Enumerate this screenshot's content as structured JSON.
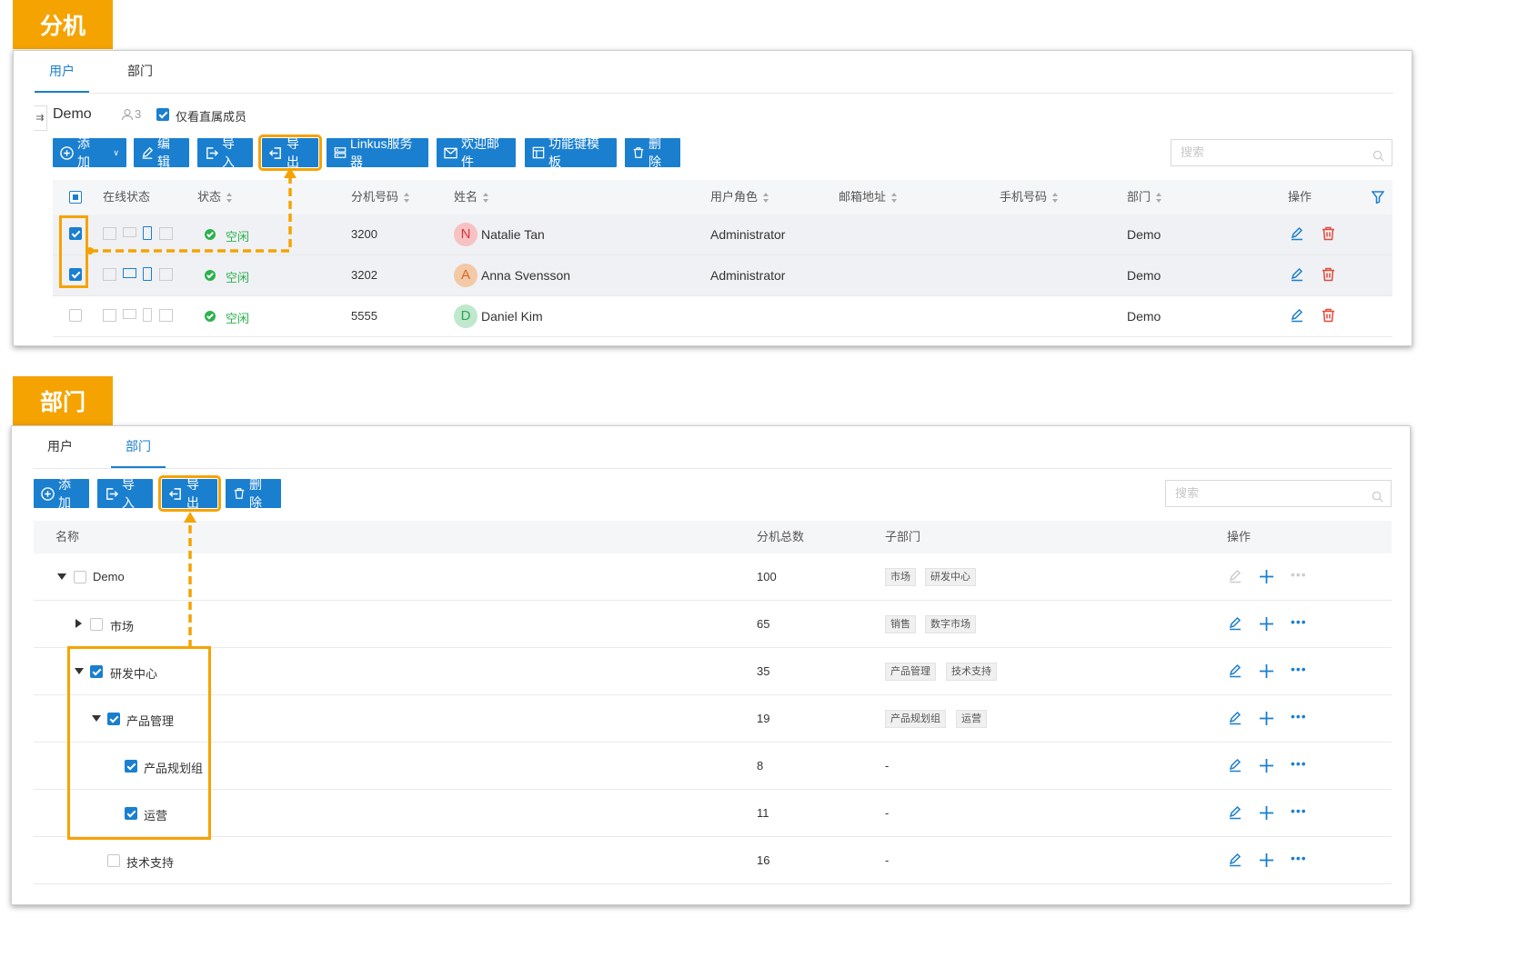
{
  "colors": {
    "accent": "#1a7fcf",
    "highlight": "#f5a300",
    "idle_green": "#2bb24c",
    "delete_red": "#e04a3a"
  },
  "section1": {
    "label": "分机",
    "tabs": [
      {
        "label": "用户",
        "active": true
      },
      {
        "label": "部门",
        "active": false
      }
    ],
    "dept_name": "Demo",
    "member_count": "3",
    "direct_only_label": "仅看直属成员",
    "toolbar": {
      "add": "添加",
      "edit": "编辑",
      "import": "导入",
      "export": "导出",
      "linkus": "Linkus服务器",
      "welcome": "欢迎邮件",
      "fkey": "功能键模板",
      "delete": "删除"
    },
    "search_placeholder": "搜索",
    "columns": {
      "online": "在线状态",
      "status": "状态",
      "ext": "分机号码",
      "name": "姓名",
      "role": "用户角色",
      "email": "邮箱地址",
      "phone": "手机号码",
      "dept": "部门",
      "ops": "操作"
    },
    "rows": [
      {
        "checked": true,
        "status": "空闲",
        "ext": "3200",
        "initial": "N",
        "name": "Natalie Tan",
        "role": "Administrator",
        "dept": "Demo"
      },
      {
        "checked": true,
        "status": "空闲",
        "ext": "3202",
        "initial": "A",
        "name": "Anna Svensson",
        "role": "Administrator",
        "dept": "Demo"
      },
      {
        "checked": false,
        "status": "空闲",
        "ext": "5555",
        "initial": "D",
        "name": "Daniel Kim",
        "role": "",
        "dept": "Demo"
      }
    ]
  },
  "section2": {
    "label": "部门",
    "tabs": [
      {
        "label": "用户",
        "active": false
      },
      {
        "label": "部门",
        "active": true
      }
    ],
    "toolbar": {
      "add": "添加",
      "import": "导入",
      "export": "导出",
      "delete": "删除"
    },
    "search_placeholder": "搜索",
    "columns": {
      "name": "名称",
      "count": "分机总数",
      "sub": "子部门",
      "ops": "操作"
    },
    "rows": [
      {
        "name": "Demo",
        "count": "100",
        "sub": [
          "市场",
          "研发中心"
        ],
        "expand": "down",
        "checked": false
      },
      {
        "name": "市场",
        "count": "65",
        "sub": [
          "销售",
          "数字市场"
        ],
        "expand": "right",
        "checked": false
      },
      {
        "name": "研发中心",
        "count": "35",
        "sub": [
          "产品管理",
          "技术支持"
        ],
        "expand": "down",
        "checked": true
      },
      {
        "name": "产品管理",
        "count": "19",
        "sub": [
          "产品规划组",
          "运营"
        ],
        "expand": "down",
        "checked": true
      },
      {
        "name": "产品规划组",
        "count": "8",
        "sub_text": "-",
        "checked": true
      },
      {
        "name": "运营",
        "count": "11",
        "sub_text": "-",
        "checked": true
      },
      {
        "name": "技术支持",
        "count": "16",
        "sub_text": "-",
        "checked": false
      }
    ]
  }
}
